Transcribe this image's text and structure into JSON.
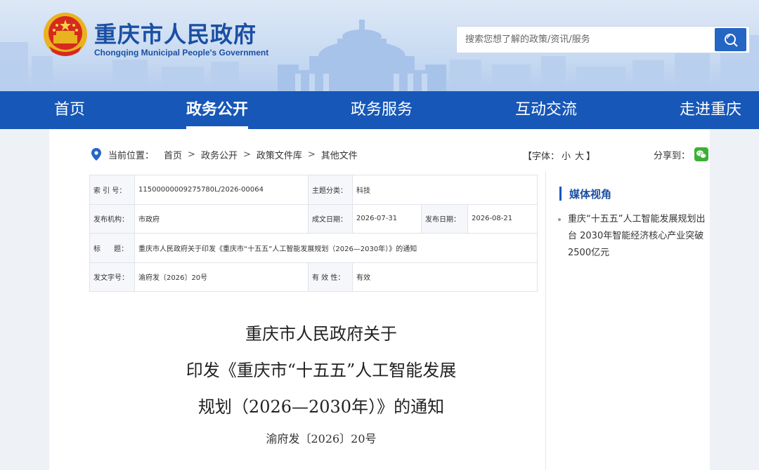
{
  "header": {
    "title_cn": "重庆市人民政府",
    "title_en": "Chongqing Municipal People's Government",
    "search_placeholder": "搜索您想了解的政策/资讯/服务"
  },
  "nav": [
    "首页",
    "政务公开",
    "政务服务",
    "互动交流",
    "走进重庆"
  ],
  "breadcrumb": {
    "label": "当前位置：",
    "items": [
      "首页",
      "政务公开",
      "政策文件库",
      "其他文件"
    ],
    "sep": ">"
  },
  "font_size": {
    "open": "【字体：",
    "small": "小",
    "large": "大",
    "close": "】"
  },
  "share_label": "分享到：",
  "info": {
    "index_label": "索 引 号：",
    "index_value": "11500000009275780L/2026-00064",
    "topic_label": "主题分类：",
    "topic_value": "科技",
    "issuer_label": "发布机构：",
    "issuer_value": "市政府",
    "written_label": "成文日期：",
    "written_value": "2026-07-31",
    "published_label": "发布日期：",
    "published_value": "2026-08-21",
    "title_label": "标      题：",
    "title_value": "重庆市人民政府关于印发《重庆市“十五五”人工智能发展规划（2026—2030年）》的通知",
    "docno_label": "发文字号：",
    "docno_value": "渝府发〔2026〕20号",
    "validity_label": "有 效 性：",
    "validity_value": "有效"
  },
  "side": {
    "title": "媒体视角",
    "item": "重庆“十五五”人工智能发展规划出台 2030年智能经济核心产业突破2500亿元"
  },
  "doc": {
    "line1": "重庆市人民政府关于",
    "line2": "印发《重庆市“十五五”人工智能发展",
    "line3": "规划（2026—2030年）》的通知",
    "number": "渝府发〔2026〕20号"
  },
  "colors": {
    "brand": "#1657b8",
    "title": "#1a4fa3"
  }
}
